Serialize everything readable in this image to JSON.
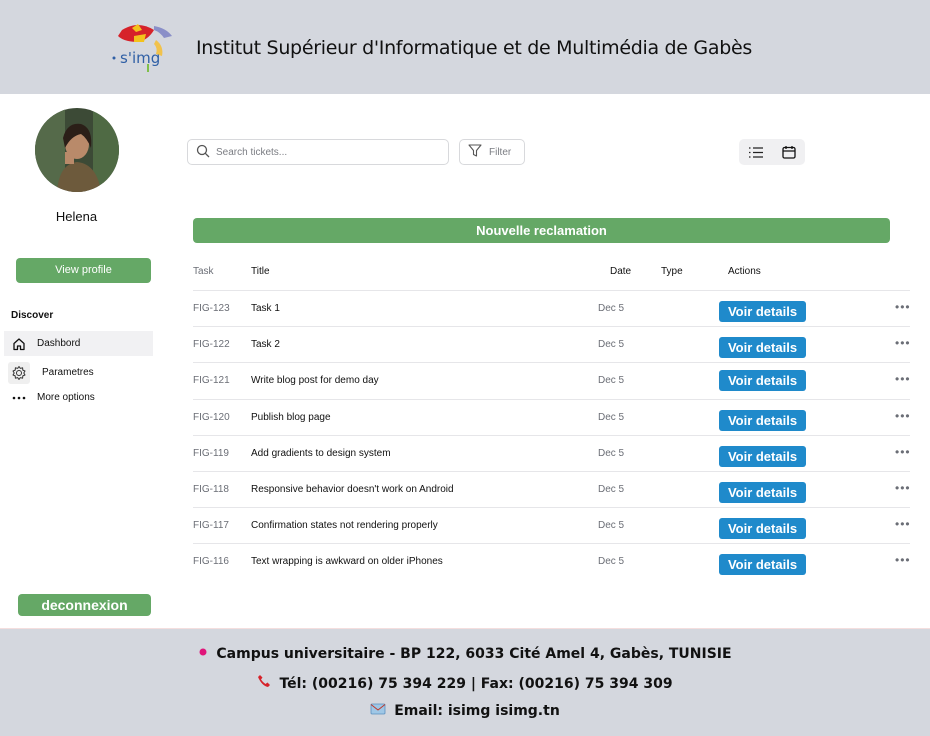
{
  "header": {
    "logo_text": "s'img",
    "title": "Institut Supérieur d'Informatique et de Multimédia de Gabès"
  },
  "sidebar": {
    "username": "Helena",
    "view_profile": "View profile",
    "section": "Discover",
    "items": [
      {
        "label": "Dashbord",
        "icon": "home-icon",
        "active": true
      },
      {
        "label": "Parametres",
        "icon": "gear-icon",
        "active": false
      },
      {
        "label": "More options",
        "icon": "more-icon",
        "active": false
      }
    ],
    "logout": "deconnexion"
  },
  "toolbar": {
    "search_placeholder": "Search tickets...",
    "filter": "Filter"
  },
  "new_claim": "Nouvelle reclamation",
  "table": {
    "headers": {
      "task": "Task",
      "title": "Title",
      "date": "Date",
      "type": "Type",
      "actions": "Actions"
    },
    "details_label": "Voir details",
    "rows": [
      {
        "task": "FIG-123",
        "title": "Task 1",
        "date": "Dec 5"
      },
      {
        "task": "FIG-122",
        "title": "Task 2",
        "date": "Dec 5"
      },
      {
        "task": "FIG-121",
        "title": "Write blog post for demo day",
        "date": "Dec 5"
      },
      {
        "task": "FIG-120",
        "title": "Publish blog page",
        "date": "Dec 5"
      },
      {
        "task": "FIG-119",
        "title": "Add gradients to design system",
        "date": "Dec 5"
      },
      {
        "task": "FIG-118",
        "title": "Responsive behavior doesn't work on Android",
        "date": "Dec 5"
      },
      {
        "task": "FIG-117",
        "title": "Confirmation states not rendering properly",
        "date": "Dec 5"
      },
      {
        "task": "FIG-116",
        "title": "Text wrapping is awkward on older iPhones",
        "date": "Dec 5"
      }
    ]
  },
  "footer": {
    "address": "Campus universitaire - BP 122, 6033 Cité Amel 4, Gabès, TUNISIE",
    "phone": "Tél: (00216) 75 394 229 | Fax: (00216) 75 394 309",
    "email": "Email: isimg isimg.tn"
  },
  "colors": {
    "header_bg": "#d4d7de",
    "green": "#65a866",
    "blue": "#1f8acb"
  }
}
